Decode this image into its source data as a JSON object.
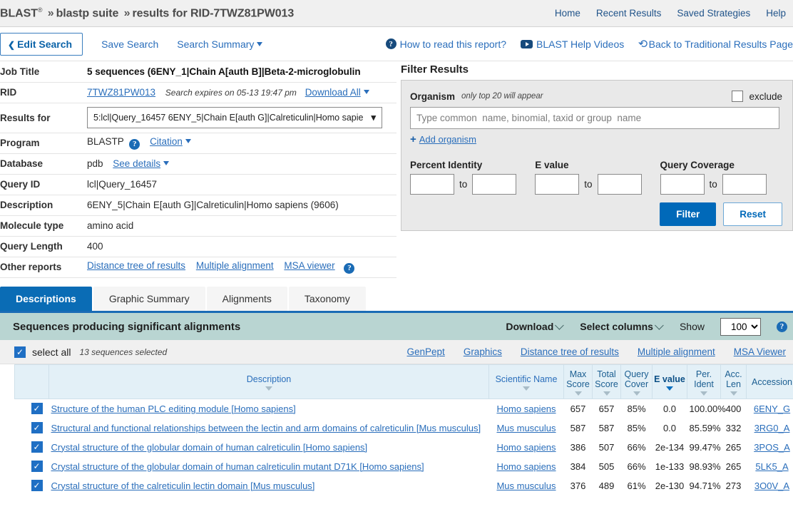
{
  "header": {
    "brand": "BLAST",
    "registered": "®",
    "crumb_suite": "blastp suite",
    "crumb_results": "results for RID-7TWZ81PW013",
    "sep": "»",
    "nav": [
      {
        "label": "Home"
      },
      {
        "label": "Recent Results"
      },
      {
        "label": "Saved Strategies"
      },
      {
        "label": "Help"
      }
    ]
  },
  "actionbar": {
    "edit_search": "Edit Search",
    "save_search": "Save Search",
    "search_summary": "Search Summary",
    "how_to_read": "How to read this report?",
    "help_videos": "BLAST Help Videos",
    "back_traditional": "Back to Traditional Results Page"
  },
  "jobinfo": {
    "rows": [
      {
        "key": "Job Title",
        "value": "5 sequences (6ENY_1|Chain A[auth B]|Beta-2-microglobulin"
      },
      {
        "key": "RID",
        "value": "7TWZ81PW013"
      },
      {
        "key": "Results for",
        "value": "5:lcl|Query_16457 6ENY_5|Chain E[auth G]|Calreticulin|Homo sapie"
      },
      {
        "key": "Program",
        "value": "BLASTP"
      },
      {
        "key": "Database",
        "value": "pdb"
      },
      {
        "key": "Query ID",
        "value": "lcl|Query_16457"
      },
      {
        "key": "Description",
        "value": "6ENY_5|Chain E[auth G]|Calreticulin|Homo sapiens (9606)"
      },
      {
        "key": "Molecule type",
        "value": "amino acid"
      },
      {
        "key": "Query Length",
        "value": "400"
      },
      {
        "key": "Other reports",
        "value": ""
      }
    ],
    "rid_link": "7TWZ81PW013",
    "expires": "Search expires on 05-13 19:47 pm",
    "download_all": "Download All",
    "citation": "Citation",
    "see_details": "See details",
    "other_reports": [
      {
        "label": "Distance tree of results"
      },
      {
        "label": "Multiple alignment"
      },
      {
        "label": "MSA viewer"
      }
    ]
  },
  "filter": {
    "title": "Filter Results",
    "organism_label": "Organism",
    "organism_note": "only top 20 will appear",
    "exclude_label": "exclude",
    "organism_placeholder": "Type common  name, binomial, taxid or group  name",
    "organism_value": "",
    "add_organism": "Add organism",
    "percent_identity_label": "Percent Identity",
    "evalue_label": "E value",
    "query_coverage_label": "Query Coverage",
    "to_label": "to",
    "pid_from": "",
    "pid_to": "",
    "ev_from": "",
    "ev_to": "",
    "qc_from": "",
    "qc_to": "",
    "filter_button": "Filter",
    "reset_button": "Reset"
  },
  "tabs": [
    {
      "label": "Descriptions",
      "active": true
    },
    {
      "label": "Graphic Summary",
      "active": false
    },
    {
      "label": "Alignments",
      "active": false
    },
    {
      "label": "Taxonomy",
      "active": false
    }
  ],
  "results_header": {
    "title": "Sequences producing significant alignments",
    "download": "Download",
    "select_columns": "Select columns",
    "show_label": "Show",
    "show_value": "100"
  },
  "select_bar": {
    "select_all": "select all",
    "count_text": "13 sequences selected",
    "links": [
      {
        "label": "GenPept"
      },
      {
        "label": "Graphics"
      },
      {
        "label": "Distance tree of results"
      },
      {
        "label": "Multiple alignment"
      },
      {
        "label": "MSA Viewer"
      }
    ]
  },
  "table": {
    "columns": [
      {
        "label": "Description",
        "sorted": false
      },
      {
        "label": "Scientific Name",
        "sorted": false
      },
      {
        "label": "Max Score",
        "sorted": false
      },
      {
        "label": "Total Score",
        "sorted": false
      },
      {
        "label": "Query Cover",
        "sorted": false
      },
      {
        "label": "E value",
        "sorted": true
      },
      {
        "label": "Per. Ident",
        "sorted": false
      },
      {
        "label": "Acc. Len",
        "sorted": false
      },
      {
        "label": "Accession",
        "sorted": false
      }
    ],
    "rows": [
      {
        "checked": true,
        "description": "Structure of the human PLC editing module [Homo sapiens]",
        "scientific_name": "Homo sapiens",
        "max_score": "657",
        "total_score": "657",
        "query_cover": "85%",
        "e_value": "0.0",
        "per_ident": "100.00%",
        "acc_len": "400",
        "accession": "6ENY_G"
      },
      {
        "checked": true,
        "description": "Structural and functional relationships between the lectin and arm domains of calreticulin [Mus musculus]",
        "scientific_name": "Mus musculus",
        "max_score": "587",
        "total_score": "587",
        "query_cover": "85%",
        "e_value": "0.0",
        "per_ident": "85.59%",
        "acc_len": "332",
        "accession": "3RG0_A"
      },
      {
        "checked": true,
        "description": "Crystal structure of the globular domain of human calreticulin [Homo sapiens]",
        "scientific_name": "Homo sapiens",
        "max_score": "386",
        "total_score": "507",
        "query_cover": "66%",
        "e_value": "2e-134",
        "per_ident": "99.47%",
        "acc_len": "265",
        "accession": "3POS_A"
      },
      {
        "checked": true,
        "description": "Crystal structure of the globular domain of human calreticulin mutant D71K [Homo sapiens]",
        "scientific_name": "Homo sapiens",
        "max_score": "384",
        "total_score": "505",
        "query_cover": "66%",
        "e_value": "1e-133",
        "per_ident": "98.93%",
        "acc_len": "265",
        "accession": "5LK5_A"
      },
      {
        "checked": true,
        "description": "Crystal structure of the calreticulin lectin domain [Mus musculus]",
        "scientific_name": "Mus musculus",
        "max_score": "376",
        "total_score": "489",
        "query_cover": "61%",
        "e_value": "2e-130",
        "per_ident": "94.71%",
        "acc_len": "273",
        "accession": "3O0V_A"
      }
    ]
  },
  "colors": {
    "accent_blue": "#0a6cb5",
    "link_blue": "#2a6ebb",
    "teal_header": "#b9d5d2",
    "table_header": "#e3f0f7"
  }
}
